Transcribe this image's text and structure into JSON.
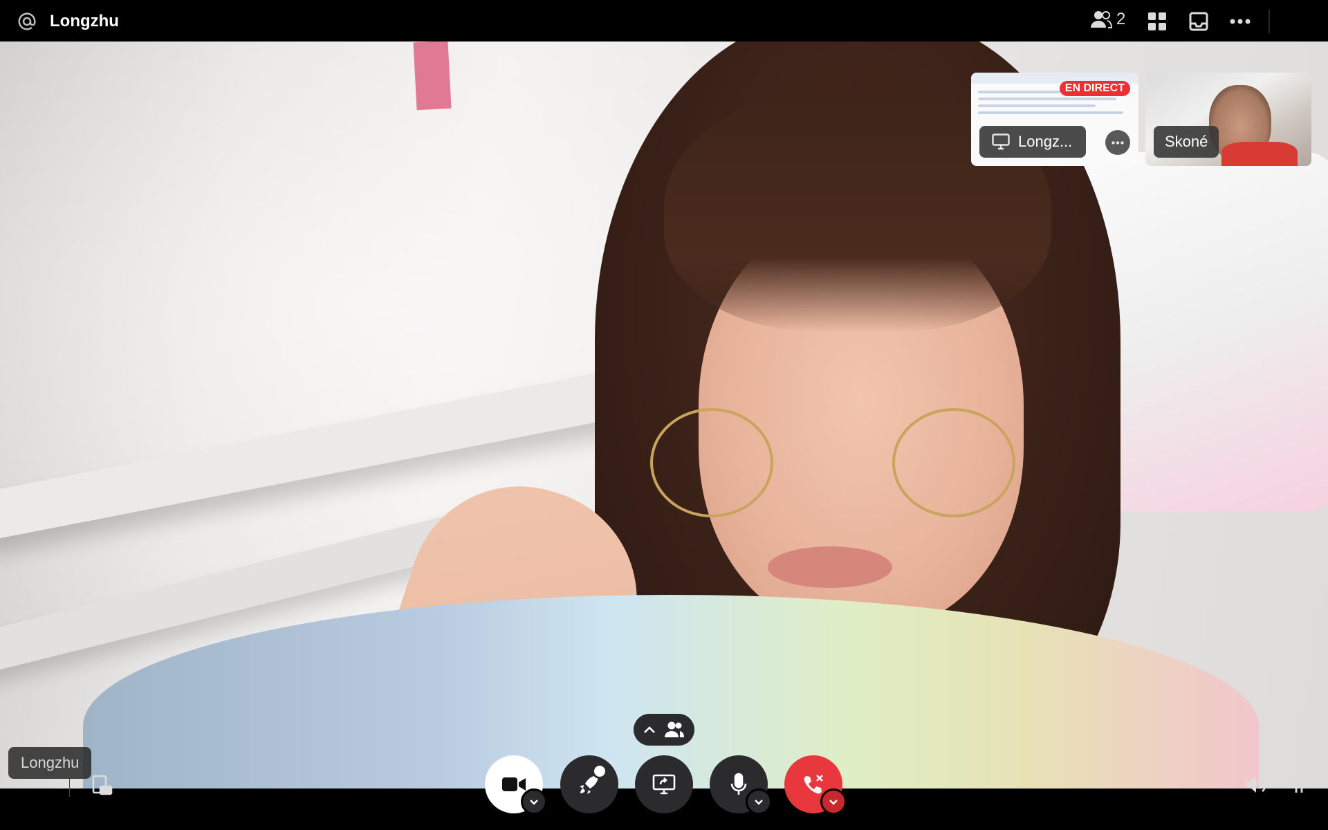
{
  "header": {
    "title": "Longzhu",
    "participant_count": "2"
  },
  "thumbnails": [
    {
      "label": "Longz...",
      "badge": "EN DIRECT",
      "type": "screen-share"
    },
    {
      "label": "Skoné",
      "type": "camera"
    }
  ],
  "main_video": {
    "name_label": "Longzhu"
  },
  "icons": {
    "header": [
      "at-icon",
      "people-icon",
      "grid-icon",
      "inbox-icon",
      "more-icon"
    ],
    "controls": [
      "camera-icon",
      "activity-rocket-icon",
      "screen-share-icon",
      "microphone-icon",
      "end-call-icon"
    ],
    "bottom_left": [
      "chevron-down-icon",
      "pop-out-icon"
    ],
    "bottom_right": [
      "volume-icon",
      "exit-fullscreen-icon"
    ]
  },
  "colors": {
    "live_badge": "#ed2f34",
    "end_call": "#e8383d",
    "control_bg": "#2b2b2e"
  }
}
